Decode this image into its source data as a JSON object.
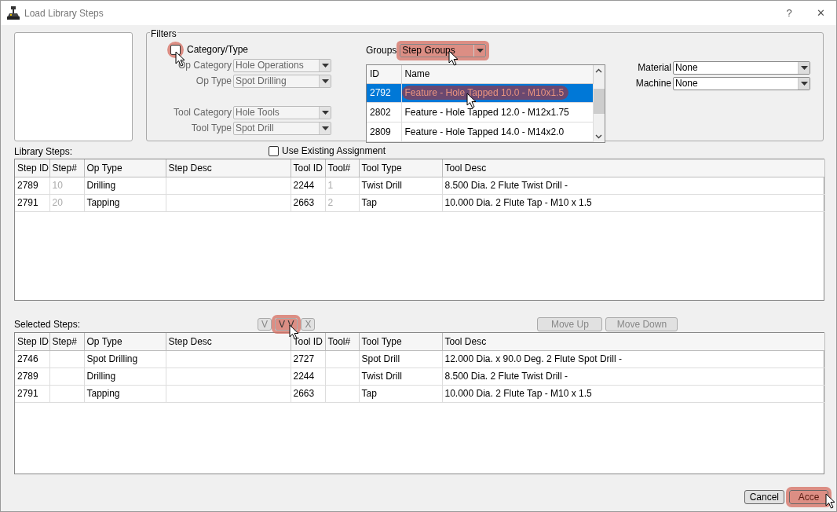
{
  "window": {
    "title": "Load Library Steps",
    "controls": [
      "?",
      "✕"
    ]
  },
  "filters": {
    "title": "Filters",
    "category_type": {
      "label": "Category/Type",
      "checked": false,
      "highlighted": true,
      "cursor": true
    },
    "fields": [
      {
        "label": "Op Category",
        "value": "Hole Operations",
        "disabled": true
      },
      {
        "label": "Op Type",
        "value": "Spot Drilling",
        "disabled": true
      },
      {
        "label": "Tool Category",
        "value": "Hole Tools",
        "disabled": true
      },
      {
        "label": "Tool Type",
        "value": "Spot Drill",
        "disabled": true
      }
    ],
    "groups": {
      "label": "Groups",
      "value": "Step Groups",
      "highlighted": true,
      "cursor": true
    },
    "group_list": {
      "columns": [
        "ID",
        "Name"
      ],
      "rows": [
        {
          "id": "2792",
          "name": "Feature - Hole Tapped 10.0 - M10x1.5",
          "selected": true,
          "highlighted": true,
          "cursor": true
        },
        {
          "id": "2802",
          "name": "Feature - Hole Tapped 12.0 - M12x1.75",
          "selected": false,
          "highlighted": false,
          "cursor": false
        },
        {
          "id": "2809",
          "name": "Feature - Hole Tapped 14.0 - M14x2.0",
          "selected": false,
          "highlighted": false,
          "cursor": false
        }
      ]
    },
    "material": {
      "label": "Material",
      "value": "None"
    },
    "machine": {
      "label": "Machine",
      "value": "None"
    }
  },
  "library_steps": {
    "label": "Library Steps:",
    "use_existing": {
      "label": "Use Existing Assignment",
      "checked": false
    },
    "columns": [
      "Step ID",
      "Step#",
      "Op Type",
      "Step Desc",
      "Tool ID",
      "Tool#",
      "Tool Type",
      "Tool Desc"
    ],
    "rows": [
      [
        "2789",
        {
          "text": "10",
          "greyed": true
        },
        "Drilling",
        "",
        "2244",
        {
          "text": "1",
          "greyed": true
        },
        "Twist Drill",
        "8.500 Dia. 2 Flute Twist Drill -"
      ],
      [
        "2791",
        {
          "text": "20",
          "greyed": true
        },
        "Tapping",
        "",
        "2663",
        {
          "text": "2",
          "greyed": true
        },
        "Tap",
        "10.000 Dia. 2 Flute Tap - M10 x 1.5"
      ]
    ]
  },
  "selected_steps": {
    "label": "Selected Steps:",
    "transfer_buttons": [
      {
        "label": "V",
        "highlighted": false,
        "cursor": false
      },
      {
        "label": "V V",
        "highlighted": true,
        "cursor": true
      },
      {
        "label": "X",
        "highlighted": false,
        "cursor": false
      }
    ],
    "order_buttons": [
      {
        "label": "Move Up",
        "disabled": true
      },
      {
        "label": "Move Down",
        "disabled": true
      }
    ],
    "columns": [
      "Step ID",
      "Step#",
      "Op Type",
      "Step Desc",
      "Tool ID",
      "Tool#",
      "Tool Type",
      "Tool Desc"
    ],
    "rows": [
      [
        "2746",
        "",
        "Spot Drilling",
        "",
        "2727",
        "",
        "Spot Drill",
        "12.000 Dia. x 90.0 Deg. 2 Flute Spot Drill -"
      ],
      [
        "2789",
        "",
        "Drilling",
        "",
        "2244",
        "",
        "Twist Drill",
        "8.500 Dia. 2 Flute Twist Drill -"
      ],
      [
        "2791",
        "",
        "Tapping",
        "",
        "2663",
        "",
        "Tap",
        "10.000 Dia. 2 Flute Tap - M10 x 1.5"
      ]
    ]
  },
  "footer_buttons": [
    {
      "label": "Cancel",
      "highlighted": false,
      "cursor": false
    },
    {
      "label": "Acce",
      "highlighted": true,
      "cursor": true
    }
  ]
}
